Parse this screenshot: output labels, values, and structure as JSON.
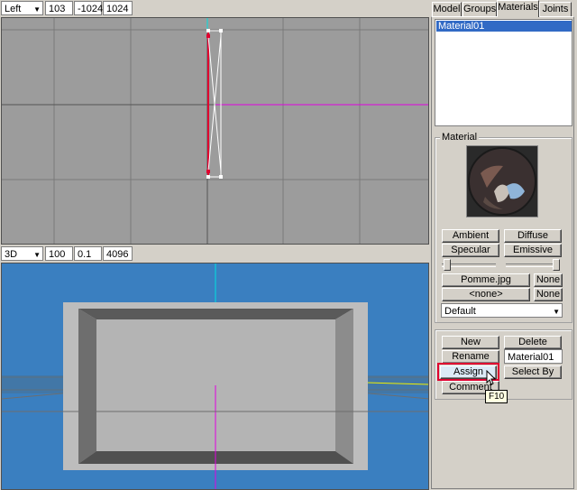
{
  "top_toolbar": {
    "view": "Left",
    "values": [
      "103",
      "-1024",
      "1024"
    ]
  },
  "bottom_toolbar": {
    "view": "3D",
    "values": [
      "100",
      "0.1",
      "4096"
    ]
  },
  "tabs": [
    {
      "label": "Model"
    },
    {
      "label": "Groups"
    },
    {
      "label": "Materials"
    },
    {
      "label": "Joints"
    }
  ],
  "materials": {
    "list": [
      "Material01"
    ],
    "group_label": "Material",
    "ambient": "Ambient",
    "diffuse": "Diffuse",
    "specular": "Specular",
    "emissive": "Emissive",
    "texture1": "Pomme.jpg",
    "none1": "None",
    "texture2": "<none>",
    "none2": "None",
    "mode": "Default",
    "new": "New",
    "delete": "Delete",
    "rename": "Rename",
    "name_value": "Material01",
    "assign": "Assign",
    "select_by": "Select By",
    "comment": "Comment",
    "tooltip": "F10"
  },
  "colors": {
    "viewport_2d": "#9c9c9c",
    "viewport_3d": "#3a7fc0",
    "selection": "#316ac5",
    "highlight": "#e00030"
  }
}
